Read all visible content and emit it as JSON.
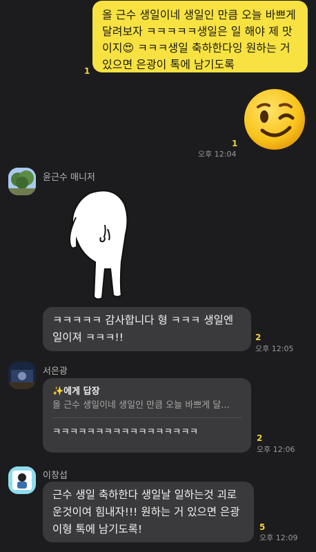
{
  "messages": [
    {
      "type": "text",
      "from": "me",
      "text_lines": [
        "올 근수 생일이네 생일인 만큼 오늘 바쁘게",
        "달려보자 ㅋㅋㅋㅋㅋ생일은 일 해야 제 맛",
        "이지😍 ㅋㅋㅋ생일 축하한다잉 원하는 거",
        "있으면 은광이 톡에 남기도록"
      ],
      "unread": "1"
    },
    {
      "type": "emoji",
      "from": "me",
      "emoji": "😉",
      "unread": "1",
      "time": "오후 12:04"
    },
    {
      "type": "sticker",
      "from": "윤근수 매니저",
      "sender": "윤근수 매니저",
      "avatar": "tree-photo-avatar"
    },
    {
      "type": "text",
      "from": "윤근수 매니저",
      "text_lines": [
        "ㅋㅋㅋㅋㅋ 감사합니다 형 ㅋㅋㅋ 생일엔",
        "일이져 ㅋㅋㅋ!!"
      ],
      "unread": "2",
      "time": "오후 12:05"
    },
    {
      "type": "reply",
      "from": "서은광",
      "sender": "서은광",
      "avatar": "dark-photo-avatar",
      "reply_header": "✨에게 답장",
      "quoted": "올 근수 생일이네 생일인 만큼 오늘 바쁘게 달...",
      "text": "ㅋㅋㅋㅋㅋㅋㅋㅋㅋㅋㅋㅋㅋㅋㅋㅋㅋ",
      "unread": "2",
      "time": "오후 12:06"
    },
    {
      "type": "text",
      "from": "이창섭",
      "sender": "이창섭",
      "avatar": "cartoon-avatar",
      "text_lines": [
        "근수 생일 축하한다 생일날 일하는것 괴로",
        "운것이여 힘내자!!! 원하는 거 있으면 은광",
        "이형 톡에 남기도록!"
      ],
      "unread": "5",
      "time": "오후 12:09"
    }
  ]
}
